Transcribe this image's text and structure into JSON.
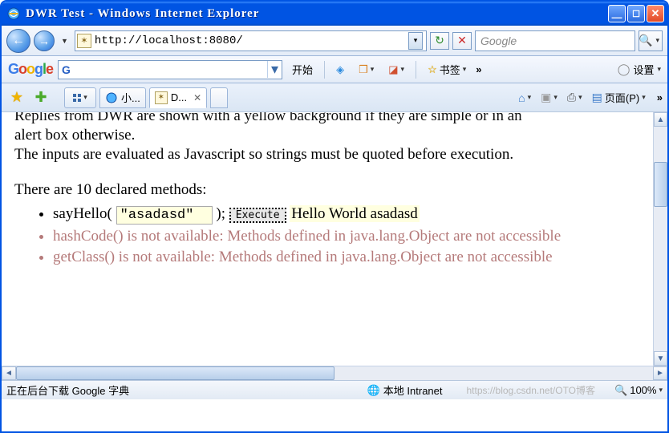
{
  "window": {
    "title": "DWR Test - Windows Internet Explorer"
  },
  "address": {
    "url": "http://localhost:8080/",
    "search_placeholder": "Google"
  },
  "google_toolbar": {
    "start_label": "开始",
    "bookmarks_label": "书签",
    "settings_label": "设置"
  },
  "tabs": {
    "tab1_label": "小...",
    "tab2_label": "D..."
  },
  "tools": {
    "page_label": "页面(P)"
  },
  "page": {
    "cut_line": "Replies from DWR are shown with a yellow background if they are simple or in an",
    "p1": "alert box otherwise.",
    "p2": "The inputs are evaluated as Javascript so strings must be quoted before execution.",
    "p3": "There are 10 declared methods:",
    "method1_name": "sayHello",
    "method1_input": "\"asadasd\"",
    "execute_label": "Execute",
    "method1_result": "Hello World asadasd",
    "method2_text": "hashCode() is not available: Methods defined in java.lang.Object are not accessible",
    "method3_text": "getClass() is not available: Methods defined in java.lang.Object are not accessible"
  },
  "status": {
    "left": "正在后台下载 Google 字典",
    "zone": "本地 Intranet",
    "watermark": "https://blog.csdn.net/OTO博客",
    "zoom": "100%"
  }
}
